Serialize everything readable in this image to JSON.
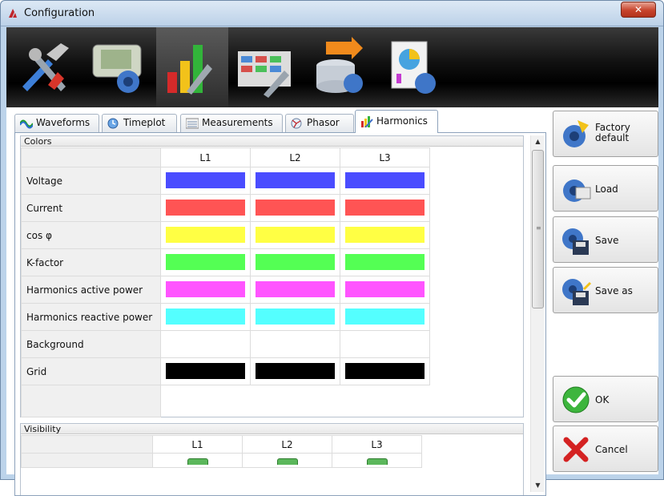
{
  "window": {
    "title": "Configuration",
    "close_glyph": "✕"
  },
  "toolbar": {
    "items": [
      {
        "icon": "tools-icon"
      },
      {
        "icon": "device-settings-icon"
      },
      {
        "icon": "bar-chart-tools-icon"
      },
      {
        "icon": "table-tools-icon"
      },
      {
        "icon": "database-import-icon"
      },
      {
        "icon": "report-settings-icon"
      }
    ],
    "active_index": 2
  },
  "tabs": [
    {
      "label": "Waveforms",
      "icon": "waveforms-icon"
    },
    {
      "label": "Timeplot",
      "icon": "timeplot-icon"
    },
    {
      "label": "Measurements",
      "icon": "measurements-icon"
    },
    {
      "label": "Phasor",
      "icon": "phasor-icon"
    },
    {
      "label": "Harmonics",
      "icon": "harmonics-icon"
    }
  ],
  "selected_tab": "Harmonics",
  "colors_group": {
    "title": "Colors",
    "columns": [
      "L1",
      "L2",
      "L3"
    ],
    "rows": [
      {
        "label": "Voltage",
        "colors": [
          "#4a4cff",
          "#4a4cff",
          "#4a4cff"
        ]
      },
      {
        "label": "Current",
        "colors": [
          "#ff5454",
          "#ff5454",
          "#ff5454"
        ]
      },
      {
        "label": "cos φ",
        "colors": [
          "#ffff44",
          "#ffff44",
          "#ffff44"
        ]
      },
      {
        "label": "K-factor",
        "colors": [
          "#54ff54",
          "#54ff54",
          "#54ff54"
        ]
      },
      {
        "label": "Harmonics active power",
        "colors": [
          "#ff54ff",
          "#ff54ff",
          "#ff54ff"
        ]
      },
      {
        "label": "Harmonics reactive power",
        "colors": [
          "#54ffff",
          "#54ffff",
          "#54ffff"
        ]
      },
      {
        "label": "Background",
        "colors": [
          "#ffffff",
          "#ffffff",
          "#ffffff"
        ]
      },
      {
        "label": "Grid",
        "colors": [
          "#000000",
          "#000000",
          "#000000"
        ]
      }
    ]
  },
  "visibility_group": {
    "title": "Visibility",
    "columns": [
      "L1",
      "L2",
      "L3"
    ]
  },
  "side_buttons": {
    "factory_default": "Factory default",
    "load": "Load",
    "save": "Save",
    "save_as": "Save as",
    "ok": "OK",
    "cancel": "Cancel"
  },
  "accent_colors": {
    "title_bar": "#bcd1e8",
    "close_button": "#c7442c",
    "ok_check": "#3db53d",
    "cancel_x": "#d42222"
  }
}
